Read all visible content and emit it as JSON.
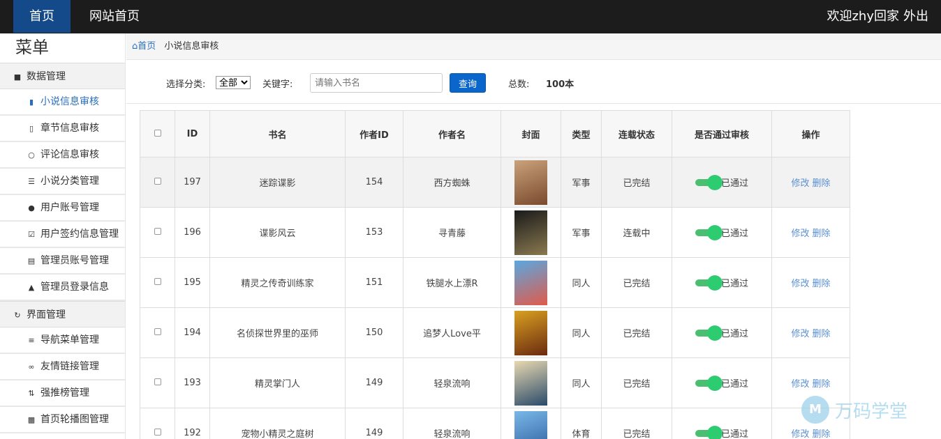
{
  "nav": {
    "home": "首页",
    "site_home": "网站首页",
    "welcome": "欢迎zhy回家",
    "logout": "外出"
  },
  "sidebar": {
    "title": "菜单",
    "groups": [
      {
        "label": "数据管理",
        "icon": "database-icon",
        "items": [
          {
            "label": "小说信息审核",
            "icon": "book-icon",
            "active": true
          },
          {
            "label": "章节信息审核",
            "icon": "file-icon"
          },
          {
            "label": "评论信息审核",
            "icon": "comment-icon"
          },
          {
            "label": "小说分类管理",
            "icon": "list-icon"
          },
          {
            "label": "用户账号管理",
            "icon": "user-icon"
          },
          {
            "label": "用户签约信息管理",
            "icon": "check-square-icon"
          },
          {
            "label": "管理员账号管理",
            "icon": "id-card-icon"
          },
          {
            "label": "管理员登录信息",
            "icon": "lock-icon"
          }
        ]
      },
      {
        "label": "界面管理",
        "icon": "refresh-icon",
        "items": [
          {
            "label": "导航菜单管理",
            "icon": "menu-icon"
          },
          {
            "label": "友情链接管理",
            "icon": "link-icon"
          },
          {
            "label": "强推榜管理",
            "icon": "sort-icon"
          },
          {
            "label": "首页轮播图管理",
            "icon": "image-icon"
          }
        ]
      }
    ]
  },
  "breadcrumb": {
    "home": "首页",
    "current": "小说信息审核"
  },
  "filter": {
    "category_label": "选择分类:",
    "category_selected": "全部",
    "keyword_label": "关键字:",
    "keyword_placeholder": "请输入书名",
    "search_button": "查询",
    "total_label": "总数:",
    "total_value": "100本"
  },
  "table": {
    "headers": [
      "ID",
      "书名",
      "作者ID",
      "作者名",
      "封面",
      "类型",
      "连载状态",
      "是否通过审核",
      "操作"
    ],
    "edit_label": "修改",
    "delete_label": "删除",
    "rows": [
      {
        "id": "197",
        "title": "迷踪谍影",
        "author_id": "154",
        "author": "西方蜘蛛",
        "type": "军事",
        "status": "已完结",
        "approved": "已通过",
        "cover_colors": [
          "#c9a27a",
          "#7a4a2e"
        ]
      },
      {
        "id": "196",
        "title": "谍影风云",
        "author_id": "153",
        "author": "寻青藤",
        "type": "军事",
        "status": "连载中",
        "approved": "已通过",
        "cover_colors": [
          "#1a1a1a",
          "#8a7a50"
        ]
      },
      {
        "id": "195",
        "title": "精灵之传奇训练家",
        "author_id": "151",
        "author": "铁腿水上漂R",
        "type": "同人",
        "status": "已完结",
        "approved": "已通过",
        "cover_colors": [
          "#5aa8e0",
          "#e05a4a"
        ]
      },
      {
        "id": "194",
        "title": "名侦探世界里的巫师",
        "author_id": "150",
        "author": "追梦人Love平",
        "type": "同人",
        "status": "已完结",
        "approved": "已通过",
        "cover_colors": [
          "#d9a020",
          "#6a2a10"
        ]
      },
      {
        "id": "193",
        "title": "精灵掌门人",
        "author_id": "149",
        "author": "轻泉流响",
        "type": "同人",
        "status": "已完结",
        "approved": "已通过",
        "cover_colors": [
          "#e8d8b0",
          "#2a4a6a"
        ]
      },
      {
        "id": "192",
        "title": "宠物小精灵之庭树",
        "author_id": "149",
        "author": "轻泉流响",
        "type": "体育",
        "status": "已完结",
        "approved": "已通过",
        "cover_colors": [
          "#7ab8e8",
          "#2a5a9a"
        ]
      }
    ]
  },
  "watermark": {
    "text": "万码学堂"
  },
  "colors": {
    "topbar": "#1c1c1c",
    "nav_active": "#144a8a",
    "primary": "#0b66cc",
    "toggle": "#2ecc71",
    "link": "#5a8fcf"
  }
}
